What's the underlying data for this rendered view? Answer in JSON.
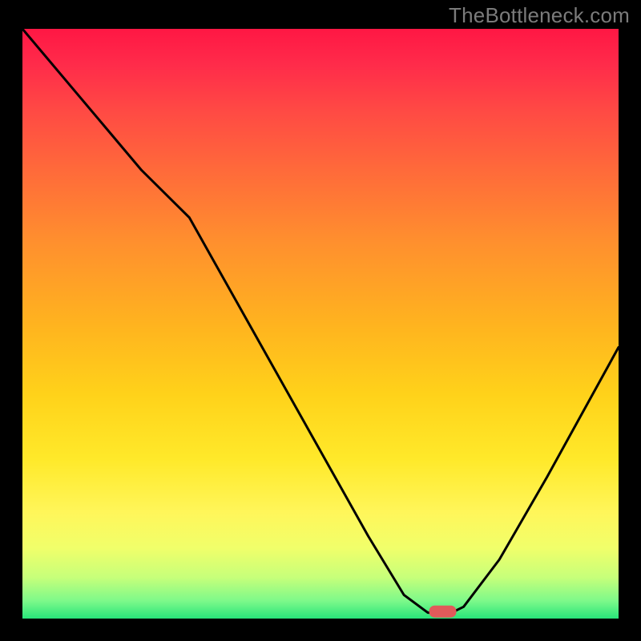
{
  "watermark": "TheBottleneck.com",
  "chart_data": {
    "type": "line",
    "title": "",
    "xlabel": "",
    "ylabel": "",
    "xlim": [
      0,
      100
    ],
    "ylim": [
      0,
      100
    ],
    "grid": false,
    "background": "rainbow-gradient red→green",
    "series": [
      {
        "name": "curve",
        "x": [
          0,
          10,
          20,
          28,
          38,
          48,
          58,
          64,
          68,
          72,
          74,
          80,
          88,
          100
        ],
        "values": [
          100,
          88,
          76,
          68,
          50,
          32,
          14,
          4,
          1,
          1,
          2,
          10,
          24,
          46
        ]
      }
    ],
    "marker": {
      "x": 70.5,
      "y": 1.2,
      "color": "#e05a5a"
    }
  }
}
